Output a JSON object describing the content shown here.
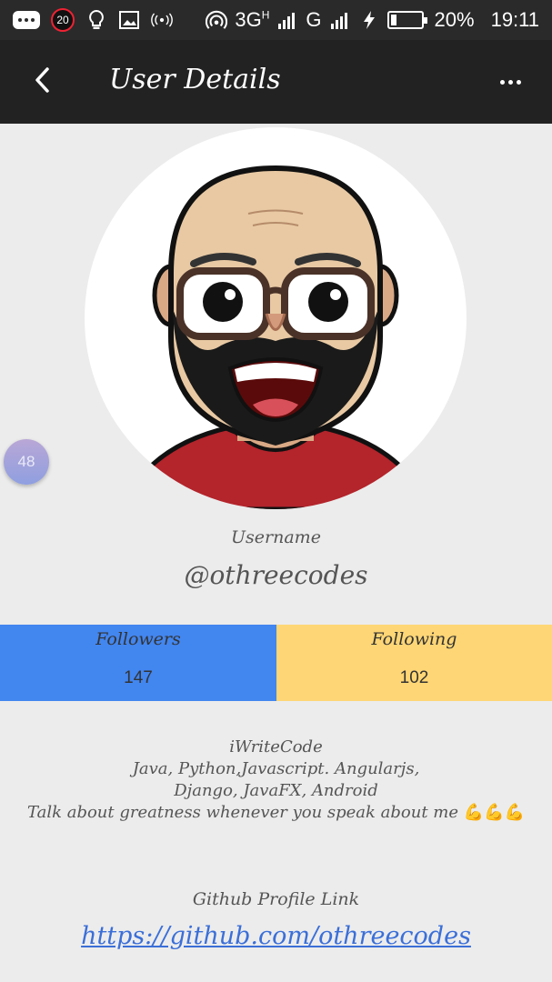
{
  "status_bar": {
    "notification_count": "20",
    "network_3g": "3G",
    "network_3g_sup": "H",
    "network_g": "G",
    "battery_percent": "20%",
    "battery_level": 0.2,
    "time": "19:11",
    "icons": [
      "chat-icon",
      "bulb-icon",
      "image-icon",
      "broadcast-icon",
      "hotspot-icon",
      "signal-icon",
      "charging-icon",
      "battery-icon"
    ]
  },
  "app_bar": {
    "title": "User Details",
    "back_icon": "chevron-left-icon",
    "menu_icon": "more-horizontal-icon"
  },
  "avatar": {
    "icon": "bitmoji-avatar"
  },
  "floating_badge": "48",
  "profile": {
    "username_label": "Username",
    "username": "@othreecodes"
  },
  "stats": {
    "followers_label": "Followers",
    "followers_value": "147",
    "following_label": "Following",
    "following_value": "102",
    "followers_color": "#4286f0",
    "following_color": "#fed675"
  },
  "bio": {
    "line1": "iWriteCode",
    "line2": "Java, Python,Javascript. Angularjs,",
    "line3": "Django, JavaFX, Android",
    "line4": "Talk about greatness whenever you speak about me",
    "emoji": "💪💪💪"
  },
  "github": {
    "label": "Github Profile Link",
    "link": "https://github.com/othreecodes",
    "link_color": "#3b6fd8"
  }
}
